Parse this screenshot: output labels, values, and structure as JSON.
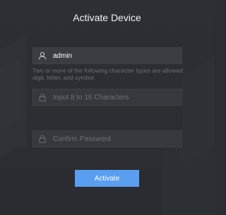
{
  "dialog": {
    "title": "Activate Device"
  },
  "username": {
    "value": "admin",
    "icon": "user-icon"
  },
  "hint": {
    "text": "Two or more of the following character types are allowed: digit, letter, and symbol"
  },
  "password": {
    "placeholder": "Input 8 to 16 Characters",
    "value": "",
    "icon": "lock-icon"
  },
  "confirm": {
    "placeholder": "Confirm Password",
    "value": "",
    "icon": "lock-icon"
  },
  "activate_button": {
    "label": "Activate",
    "color": "#5a9ef0"
  },
  "colors": {
    "background": "#2b2d32",
    "field_background": "#3a3c41",
    "hint_text": "#6a6c71"
  }
}
